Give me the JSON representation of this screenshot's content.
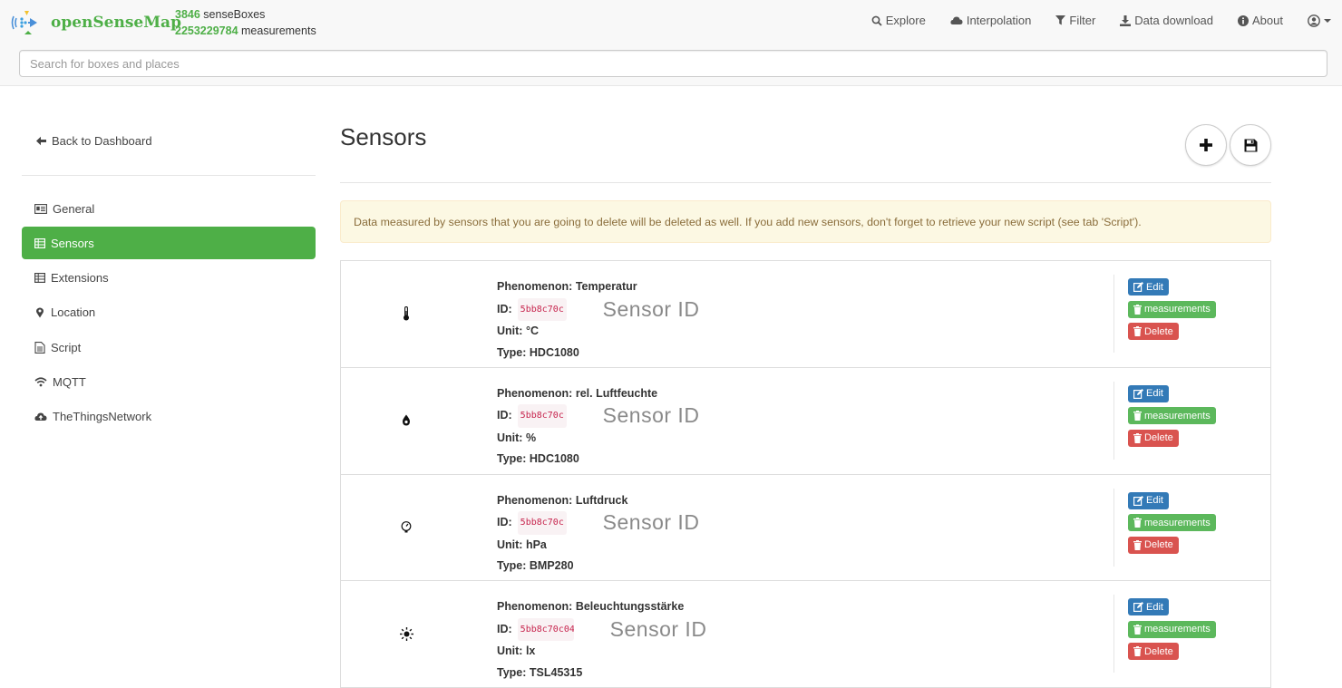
{
  "header": {
    "brand": "openSenseMap",
    "stats": {
      "boxes_count": "3846",
      "boxes_label": "senseBoxes",
      "measurements_count": "2253229784",
      "measurements_label": "measurements"
    },
    "nav": [
      {
        "label": "Explore",
        "icon": "search-icon"
      },
      {
        "label": "Interpolation",
        "icon": "cloud-icon"
      },
      {
        "label": "Filter",
        "icon": "filter-icon"
      },
      {
        "label": "Data download",
        "icon": "download-icon"
      },
      {
        "label": "About",
        "icon": "info-icon"
      }
    ],
    "user_icon": "user-circle-icon"
  },
  "search": {
    "placeholder": "Search for boxes and places",
    "value": ""
  },
  "sidebar": {
    "back_label": "Back to Dashboard",
    "items": [
      {
        "label": "General",
        "icon": "id-card-icon",
        "active": false
      },
      {
        "label": "Sensors",
        "icon": "table-icon",
        "active": true
      },
      {
        "label": "Extensions",
        "icon": "table-icon",
        "active": false
      },
      {
        "label": "Location",
        "icon": "map-marker-icon",
        "active": false
      },
      {
        "label": "Script",
        "icon": "file-text-icon",
        "active": false
      },
      {
        "label": "MQTT",
        "icon": "wifi-icon",
        "active": false
      },
      {
        "label": "TheThingsNetwork",
        "icon": "cloud-upload-icon",
        "active": false
      }
    ]
  },
  "main": {
    "title": "Sensors",
    "add_icon": "plus-icon",
    "save_icon": "floppy-icon",
    "alert": "Data measured by sensors that you are going to delete will be deleted as well. If you add new sensors, don't forget to retrieve your new script (see tab 'Script').",
    "labels": {
      "phenomenon": "Phenomenon:",
      "id": "ID:",
      "unit": "Unit:",
      "type": "Type:",
      "edit": "Edit",
      "measurements": "measurements",
      "delete": "Delete"
    },
    "sensors": [
      {
        "phenomenon": "Temperatur",
        "id": "5bb8c70c",
        "id_overlay": "Sensor ID",
        "unit": "°C",
        "type": "HDC1080",
        "icon": "thermometer-icon"
      },
      {
        "phenomenon": "rel. Luftfeuchte",
        "id": "5bb8c70c",
        "id_overlay": "Sensor ID",
        "unit": "%",
        "type": "HDC1080",
        "icon": "water-drop-icon"
      },
      {
        "phenomenon": "Luftdruck",
        "id": "5bb8c70c",
        "id_overlay": "Sensor ID",
        "unit": "hPa",
        "type": "BMP280",
        "icon": "gauge-icon"
      },
      {
        "phenomenon": "Beleuchtungsstärke",
        "id": "5bb8c70c04",
        "id_overlay": "Sensor ID",
        "unit": "lx",
        "type": "TSL45315",
        "icon": "sun-icon"
      }
    ]
  },
  "colors": {
    "brand": "#4eaf47",
    "active_nav": "#4eaf47",
    "edit": "#337ab7",
    "measurements": "#5cb85c",
    "delete": "#d9534f",
    "alert_bg": "#fcf8e3",
    "alert_text": "#8a6d3b"
  }
}
